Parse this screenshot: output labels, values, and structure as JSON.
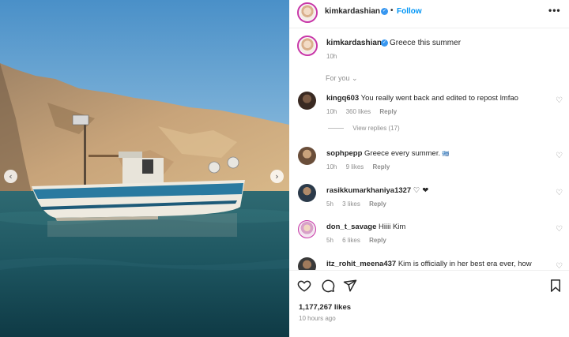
{
  "photo": {
    "prev_arrow": "‹",
    "next_arrow": "›"
  },
  "header": {
    "username": "kimkardashian",
    "separator": "•",
    "follow_label": "Follow",
    "more_label": "•••"
  },
  "caption": {
    "username": "kimkardashian",
    "text": "Greece this summer",
    "time": "10h"
  },
  "sort_label": "For you",
  "comments": [
    {
      "username": "kingq603",
      "text": "You really went back and edited to repost lmfao",
      "time": "10h",
      "likes": "360 likes",
      "reply": "Reply",
      "view_replies": "View replies (17)"
    },
    {
      "username": "sophpepp",
      "text": "Greece every summer. ",
      "time": "10h",
      "likes": "9 likes",
      "reply": "Reply"
    },
    {
      "username": "rasikkumarkhaniya1327",
      "text": "♡ ❤",
      "time": "5h",
      "likes": "3 likes",
      "reply": "Reply"
    },
    {
      "username": "don_t_savage",
      "text": "Hiiii Kim",
      "time": "5h",
      "likes": "6 likes",
      "reply": "Reply"
    },
    {
      "username": "itz_rohit_meena437",
      "text": "Kim is officially in her best era ever, how"
    }
  ],
  "footer": {
    "likes": "1,177,267 likes",
    "posted": "10 hours ago"
  },
  "icons": {
    "heart": "♡"
  }
}
